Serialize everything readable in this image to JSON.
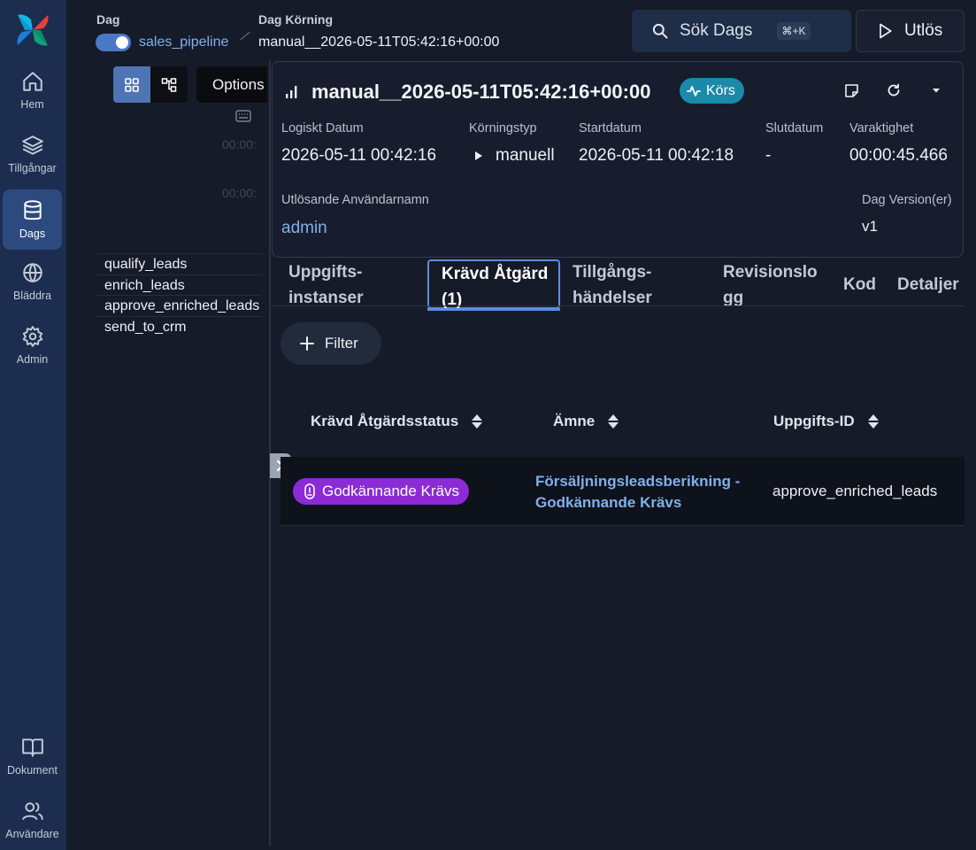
{
  "sidebar": {
    "items": [
      {
        "label": "Hem",
        "icon": "home-icon"
      },
      {
        "label": "Tillgångar",
        "icon": "layers-icon"
      },
      {
        "label": "Dags",
        "icon": "database-icon"
      },
      {
        "label": "Bläddra",
        "icon": "globe-icon"
      },
      {
        "label": "Admin",
        "icon": "gear-icon"
      },
      {
        "label": "Dokument",
        "icon": "book-icon"
      },
      {
        "label": "Användare",
        "icon": "users-icon"
      }
    ],
    "active": "Dags"
  },
  "breadcrumb": {
    "dag_label": "Dag",
    "dag_value": "sales_pipeline",
    "run_label": "Dag Körning",
    "run_value": "manual__2026-05-11T05:42:16+00:00"
  },
  "header": {
    "search_label": "Sök Dags",
    "search_shortcut": "⌘+K",
    "trigger_label": "Utlös"
  },
  "graph_panel": {
    "options_label": "Options",
    "time_labels": [
      "00:00:",
      "00:00:"
    ],
    "tasks": [
      "qualify_leads",
      "enrich_leads",
      "approve_enriched_leads",
      "send_to_crm"
    ]
  },
  "run": {
    "title": "manual__2026-05-11T05:42:16+00:00",
    "state": "Körs",
    "logical_date_label": "Logiskt Datum",
    "logical_date": "2026-05-11 00:42:16",
    "run_type_label": "Körningstyp",
    "run_type": "manuell",
    "start_label": "Startdatum",
    "start": "2026-05-11 00:42:18",
    "end_label": "Slutdatum",
    "end": "-",
    "duration_label": "Varaktighet",
    "duration": "00:00:45.466",
    "triggering_user_label": "Utlösande Användarnamn",
    "triggering_user": "admin",
    "dag_version_label": "Dag Version(er)",
    "dag_version": "v1"
  },
  "tabs": [
    {
      "label": "Uppgifts-instanser",
      "line1": "Uppgifts-",
      "line2": "instanser",
      "active": false
    },
    {
      "label": "Krävd Åtgärd (1)",
      "line1": "Krävd Åtgärd",
      "line2": "(1)",
      "active": true
    },
    {
      "label": "Tillgångs-händelser",
      "line1": "Tillgångs-",
      "line2": "händelser",
      "active": false
    },
    {
      "label": "Revisionslogg",
      "line1": "Revisionslo",
      "line2": "gg",
      "active": false
    },
    {
      "label": "Kod",
      "line1": "Kod",
      "line2": "",
      "active": false
    },
    {
      "label": "Detaljer",
      "line1": "Detaljer",
      "line2": "",
      "active": false
    }
  ],
  "filter_label": "Filter",
  "table": {
    "columns": [
      "Krävd Åtgärdsstatus",
      "Ämne",
      "Uppgifts-ID"
    ],
    "rows": [
      {
        "status": "Godkännande Krävs",
        "subject_line1": "Försäljningsleadsberikning -",
        "subject_line2": "Godkännande Krävs",
        "task_id": "approve_enriched_leads"
      }
    ]
  },
  "colors": {
    "accent": "#4f74b3",
    "running": "#1a8aa8",
    "required_action": "#8a2bd6",
    "link": "#7fb0ef"
  }
}
